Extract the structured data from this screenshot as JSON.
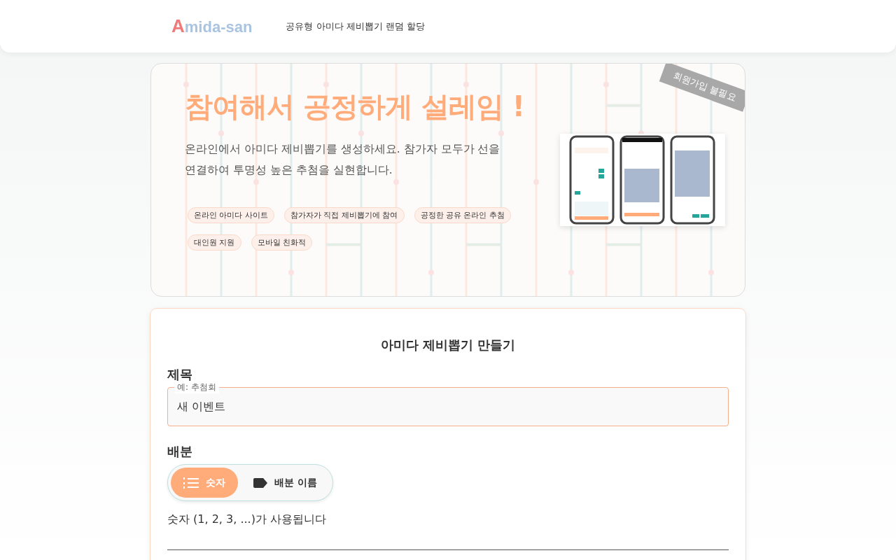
{
  "header": {
    "logo": "Amida-san",
    "tagline": "공유형 아미다 제비뽑기 랜덤 할당"
  },
  "hero": {
    "ribbon": "회원가입 불필요",
    "title": "참여해서 공정하게 설레임 !",
    "description": "온라인에서 아미다 제비뽑기를 생성하세요. 참가자 모두가 선을 연결하여 투명성 높은 추첨을 실현합니다.",
    "chips": [
      "온라인 아미다 사이트",
      "참가자가 직접 제비뽑기에 참여",
      "공정한 공유 온라인 추첨",
      "대인원 지원",
      "모바일 친화적"
    ]
  },
  "form": {
    "heading": "아미다 제비뽑기 만들기",
    "title_label": "제목",
    "title_field": {
      "placeholder": "예: 추첨회",
      "value": "새 이벤트"
    },
    "allocation_label": "배분",
    "allocation_options": [
      {
        "label": "숫자",
        "kind": "numbers",
        "selected": true
      },
      {
        "label": "배분 이름",
        "kind": "names",
        "selected": false
      }
    ],
    "allocation_hint": "숫자 (1, 2, 3, ...)가 사용됩니다"
  }
}
